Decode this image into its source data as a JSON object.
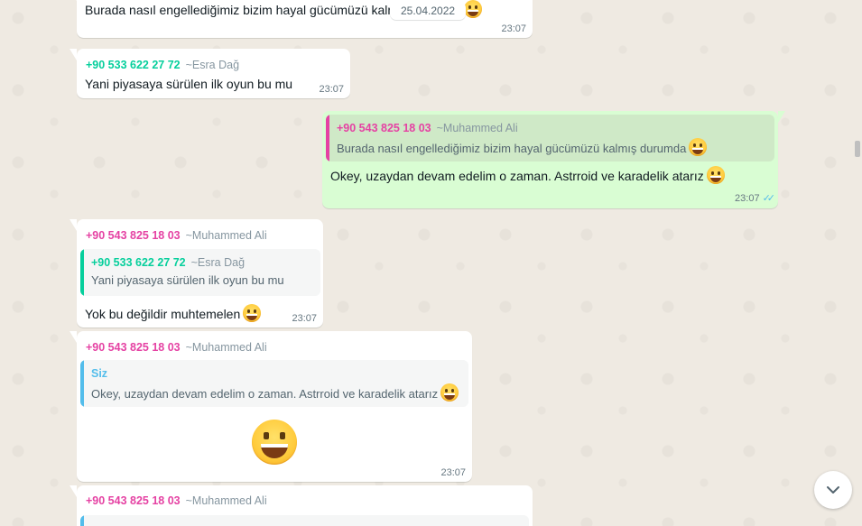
{
  "date_pill": "25.04.2022",
  "messages": [
    {
      "sender_number": "",
      "sender_name": "",
      "text": "Burada nasıl engellediğimiz bizim hayal gücümüzü kalmış durumda",
      "time": "23:07"
    },
    {
      "sender_number": "+90 533 622 27 72",
      "sender_name": "~Esra Dağ",
      "text": "Yani piyasaya sürülen ilk oyun bu mu",
      "time": "23:07"
    },
    {
      "quote_number": "+90 543 825 18 03",
      "quote_name": "~Muhammed Ali",
      "quote_text": "Burada nasıl engellediğimiz bizim hayal gücümüzü kalmış durumda",
      "text": "Okey, uzaydan devam edelim o zaman. Astrroid ve karadelik atarız",
      "time": "23:07",
      "status_icon": "double-check-read-icon"
    },
    {
      "sender_number": "+90 543 825 18 03",
      "sender_name": "~Muhammed Ali",
      "quote_number": "+90 533 622 27 72",
      "quote_name": "~Esra Dağ",
      "quote_text": "Yani piyasaya sürülen ilk oyun bu mu",
      "text": "Yok bu değildir muhtemelen",
      "time": "23:07"
    },
    {
      "sender_number": "+90 543 825 18 03",
      "sender_name": "~Muhammed Ali",
      "quote_sender": "Siz",
      "quote_text": "Okey, uzaydan devam edelim o zaman. Astrroid ve karadelik atarız",
      "big_emoji": "grinning-face-emoji",
      "time": "23:07"
    },
    {
      "sender_number": "+90 543 825 18 03",
      "sender_name": "~Muhammed Ali"
    }
  ],
  "colors": {
    "chat_background": "#efeae2",
    "incoming_bubble": "#ffffff",
    "outgoing_bubble": "#d9fdd3",
    "sender_green": "#06cf9c",
    "sender_pink": "#e542a3",
    "self_blue": "#53bdeb"
  },
  "icons": {
    "scroll_down": "chevron-down-icon",
    "emoji": "grinning-face-emoji"
  }
}
